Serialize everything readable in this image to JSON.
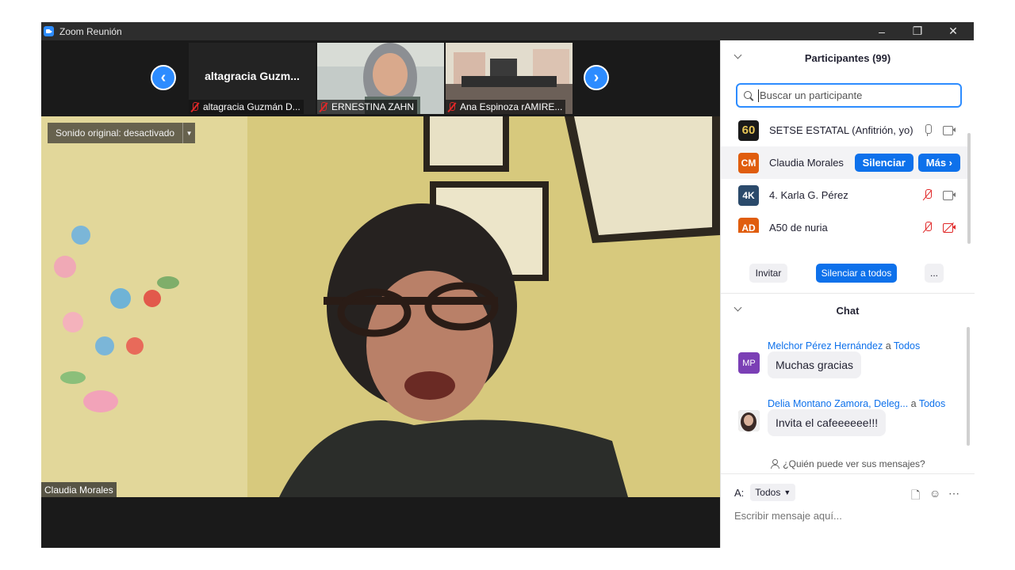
{
  "window": {
    "title": "Zoom Reunión",
    "minimize_glyph": "–",
    "restore_glyph": "❐",
    "close_glyph": "✕"
  },
  "thumbnails": {
    "prev_glyph": "‹",
    "next_glyph": "›",
    "items": [
      {
        "name": "altagracia Guzmán D...",
        "big_name": "altagracia  Guzm...",
        "muted": true
      },
      {
        "name": "ERNESTINA ZAHN",
        "muted": true
      },
      {
        "name": "Ana Espinoza rAMIRE...",
        "muted": true
      }
    ]
  },
  "main_video": {
    "sound_label": "Sonido original: desactivado",
    "speaker_name": "Claudia Morales"
  },
  "participants": {
    "header": "Participantes (99)",
    "search_placeholder": "Buscar un participante",
    "list": [
      {
        "initials": "60",
        "name": "SETSE ESTATAL (Anfitrión, yo)",
        "color": "#1a1a1a",
        "mic_muted": false,
        "cam_off": false
      },
      {
        "initials": "CM",
        "name": "Claudia Morales",
        "color": "#e05d0e"
      },
      {
        "initials": "4K",
        "name": "4. Karla G. Pérez",
        "color": "#2b4a6b",
        "mic_muted": true,
        "cam_off": false
      },
      {
        "initials": "AD",
        "name": "A50 de nuria",
        "color": "#e05d0e",
        "mic_muted": true,
        "cam_off": true
      }
    ],
    "mute_button": "Silenciar",
    "more_button": "Más ›",
    "invite": "Invitar",
    "mute_all": "Silenciar a todos",
    "overflow": "..."
  },
  "chat": {
    "header": "Chat",
    "messages": [
      {
        "initials": "MP",
        "color": "#7b3fb5",
        "from": "Melchor Pérez Hernández",
        "to_word": "a",
        "to": "Todos",
        "text": "Muchas gracias"
      },
      {
        "initials": "",
        "color": "#c9b6a8",
        "from": "Delia Montano Zamora, Deleg...",
        "to_word": "a",
        "to": "Todos",
        "text": "Invita el cafeeeeee!!!"
      }
    ],
    "who_can_see": "¿Quién puede ver sus mensajes?",
    "to_label": "A:",
    "to_value": "Todos",
    "compose_placeholder": "Escribir mensaje aquí..."
  }
}
